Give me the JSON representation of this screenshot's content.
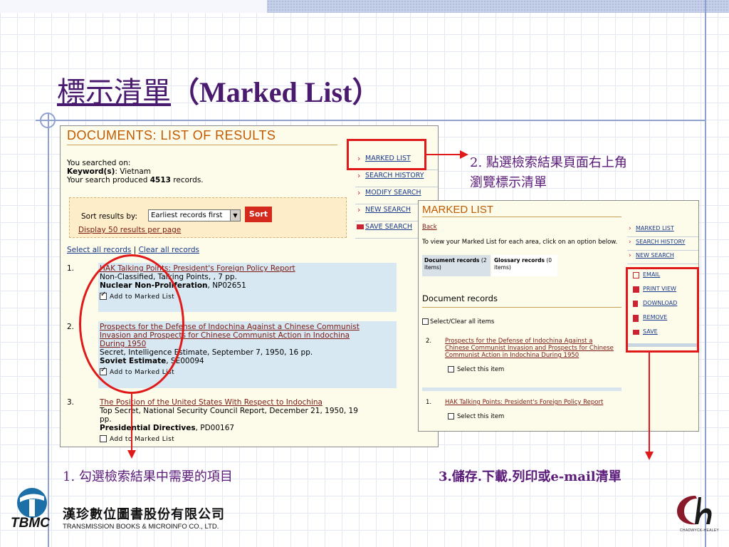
{
  "slide": {
    "title_zh": "標示清單",
    "title_open": "（",
    "title_en": "Marked List",
    "title_close": "）"
  },
  "annotations": {
    "note2_line1": "2. 點選檢索結果頁面右上角",
    "note2_line2": "瀏覽標示清單",
    "note1": "1. 勾選檢索結果中需要的項目",
    "note3": "3.儲存.下載.列印或e-mail清單"
  },
  "results_page": {
    "heading": "DOCUMENTS: LIST OF RESULTS",
    "searched_on": "You searched on:",
    "keyword_label": "Keyword(s)",
    "keyword_value": ": Vietnam",
    "produced_prefix": "Your search produced ",
    "produced_count": "4513",
    "produced_suffix": " records.",
    "right_links": [
      {
        "label": "MARKED LIST",
        "icon": "chevron-right-icon"
      },
      {
        "label": "SEARCH HISTORY",
        "icon": "chevron-right-icon"
      },
      {
        "label": "MODIFY SEARCH",
        "icon": "chevron-right-icon"
      },
      {
        "label": "NEW SEARCH",
        "icon": "chevron-right-icon"
      },
      {
        "label": "SAVE SEARCH",
        "icon": "folder-icon"
      }
    ],
    "sort_label": "Sort results by:",
    "sort_selected": "Earliest records first",
    "sort_button": "Sort",
    "display_link": "Display 50 results per page",
    "select_all": "Select all records",
    "separator": "|",
    "clear_all": "Clear all records",
    "results": [
      {
        "num": "1.",
        "title_lines": [
          "HAK Talking Points: President's Foreign Policy Report"
        ],
        "desc_lines": [
          "Non-Classified, Talking Points, , 7 pp."
        ],
        "collection_bold": "Nuclear Non-Proliferation",
        "collection_id": ", NP02651",
        "checked": true,
        "add_label": "Add to Marked List"
      },
      {
        "num": "2.",
        "title_lines": [
          "Prospects for the Defense of Indochina Against a Chinese Communist",
          "Invasion and Prospects for Chinese Communist Action in Indochina",
          "During 1950"
        ],
        "desc_lines": [
          "Secret, Intelligence Estimate, September 7, 1950, 16 pp."
        ],
        "collection_bold": "Soviet Estimate",
        "collection_id": ", SE00094",
        "checked": true,
        "add_label": "Add to Marked List"
      },
      {
        "num": "3.",
        "title_lines": [
          "The Position of the United States With Respect to Indochina"
        ],
        "desc_lines": [
          "Top Secret, National Security Council Report, December 21, 1950, 19",
          "pp."
        ],
        "collection_bold": "Presidential Directives",
        "collection_id": ", PD00167",
        "checked": false,
        "add_label": "Add to Marked List"
      }
    ]
  },
  "marked_page": {
    "heading": "MARKED LIST",
    "back": "Back",
    "instruction": "To view your Marked List for each area, click on an option below.",
    "tab_doc_bold": "Document records",
    "tab_doc_count": " (2",
    "tab_doc_items": "items)",
    "tab_glos_bold": "Glossary records",
    "tab_glos_count": " (0",
    "tab_glos_items": "items)",
    "section": "Document records",
    "select_clear": "Select/Clear all items",
    "right_links": [
      {
        "label": "MARKED LIST"
      },
      {
        "label": "SEARCH HISTORY"
      },
      {
        "label": "NEW SEARCH"
      }
    ],
    "tools": [
      {
        "label": "EMAIL",
        "icon": "email-icon"
      },
      {
        "label": "PRINT VIEW",
        "icon": "printer-icon"
      },
      {
        "label": "DOWNLOAD",
        "icon": "download-icon"
      },
      {
        "label": "REMOVE",
        "icon": "trash-icon"
      },
      {
        "label": "SAVE",
        "icon": "folder-icon"
      }
    ],
    "items": [
      {
        "num": "2.",
        "title_lines": [
          "Prospects for the Defense of Indochina Against a",
          "Chinese Communist Invasion and Prospects for Chinese",
          "Communist Action in Indochina During 1950"
        ],
        "select": "Select this item"
      },
      {
        "num": "1.",
        "title_lines": [
          "HAK Talking Points: President's Foreign Policy Report"
        ],
        "select": "Select this item"
      }
    ]
  },
  "footer": {
    "tbmc": "TBMC",
    "company_zh": "漢珍數位圖書股份有限公司",
    "company_en": "TRANSMISSION BOOKS & MICROINFO CO., LTD.",
    "ch_text": "CHADWYCK-HEALEY"
  },
  "colors": {
    "title": "#4a1a6e",
    "highlight": "#e01a1a",
    "heading_orange": "#c25a00",
    "link_red": "#7a1a12",
    "link_blue": "#1a3a8c"
  }
}
